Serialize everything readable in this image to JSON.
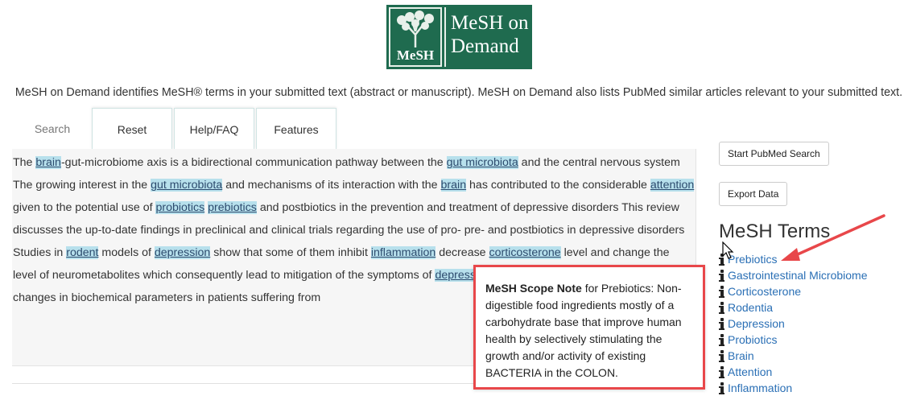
{
  "logo": {
    "mark": "MeSH",
    "line1": "MeSH on",
    "line2": "Demand"
  },
  "tagline": "MeSH on Demand identifies MeSH® terms in your submitted text (abstract or manuscript). MeSH on Demand also lists PubMed similar articles relevant to your submitted text.",
  "tabs": {
    "search": "Search",
    "reset": "Reset",
    "help": "Help/FAQ",
    "features": "Features"
  },
  "article": {
    "p1": "The ",
    "h1": "brain",
    "p2": "-gut-microbiome axis is a bidirectional communication pathway between the ",
    "h2": "gut microbiota",
    "p3": " and the central nervous system The growing interest in the ",
    "h3": "gut microbiota",
    "p4": " and mechanisms of its interaction with the ",
    "h4": "brain",
    "p5": " has contributed to the considerable ",
    "h5": "attention",
    "p6": " given to the potential use of ",
    "h6": "probiotics",
    "p7": " ",
    "h7": "prebiotics",
    "p8": " and postbiotics in the prevention and treatment of depressive disorders This review discusses the up-to-date findings in preclinical and clinical trials regarding the use of pro- pre- and postbiotics in depressive disorders Studies in ",
    "h8": "rodent",
    "p9": " models of ",
    "h9": "depression",
    "p10": " show that some of them inhibit ",
    "h10": "inflammation",
    "p11": " decrease ",
    "h11": "corticosterone",
    "p12": " level and change the level of neurometabolites which consequently lead to mitigation of the symptoms of ",
    "h12": "depression",
    "p13": " More improvement in mood as well as changes in biochemical parameters in patients suffering from"
  },
  "popup": {
    "label": "MeSH Scope Note",
    "text": " for Prebiotics: Non-digestible food ingredients mostly of a carbohydrate base that improve human health by selectively stimulating the growth and/or activity of existing BACTERIA in the COLON."
  },
  "sidebar": {
    "pubmed_button": "Start PubMed Search",
    "export_button": "Export Data",
    "terms_heading": "MeSH Terms",
    "terms": [
      "Prebiotics",
      "Gastrointestinal Microbiome",
      "Corticosterone",
      "Rodentia",
      "Depression",
      "Probiotics",
      "Brain",
      "Attention",
      "Inflammation"
    ]
  },
  "colors": {
    "logo_green": "#1f6b4f",
    "highlight": "#b7e0ec",
    "link": "#2a6fb5",
    "annotation_red": "#e8474a"
  }
}
